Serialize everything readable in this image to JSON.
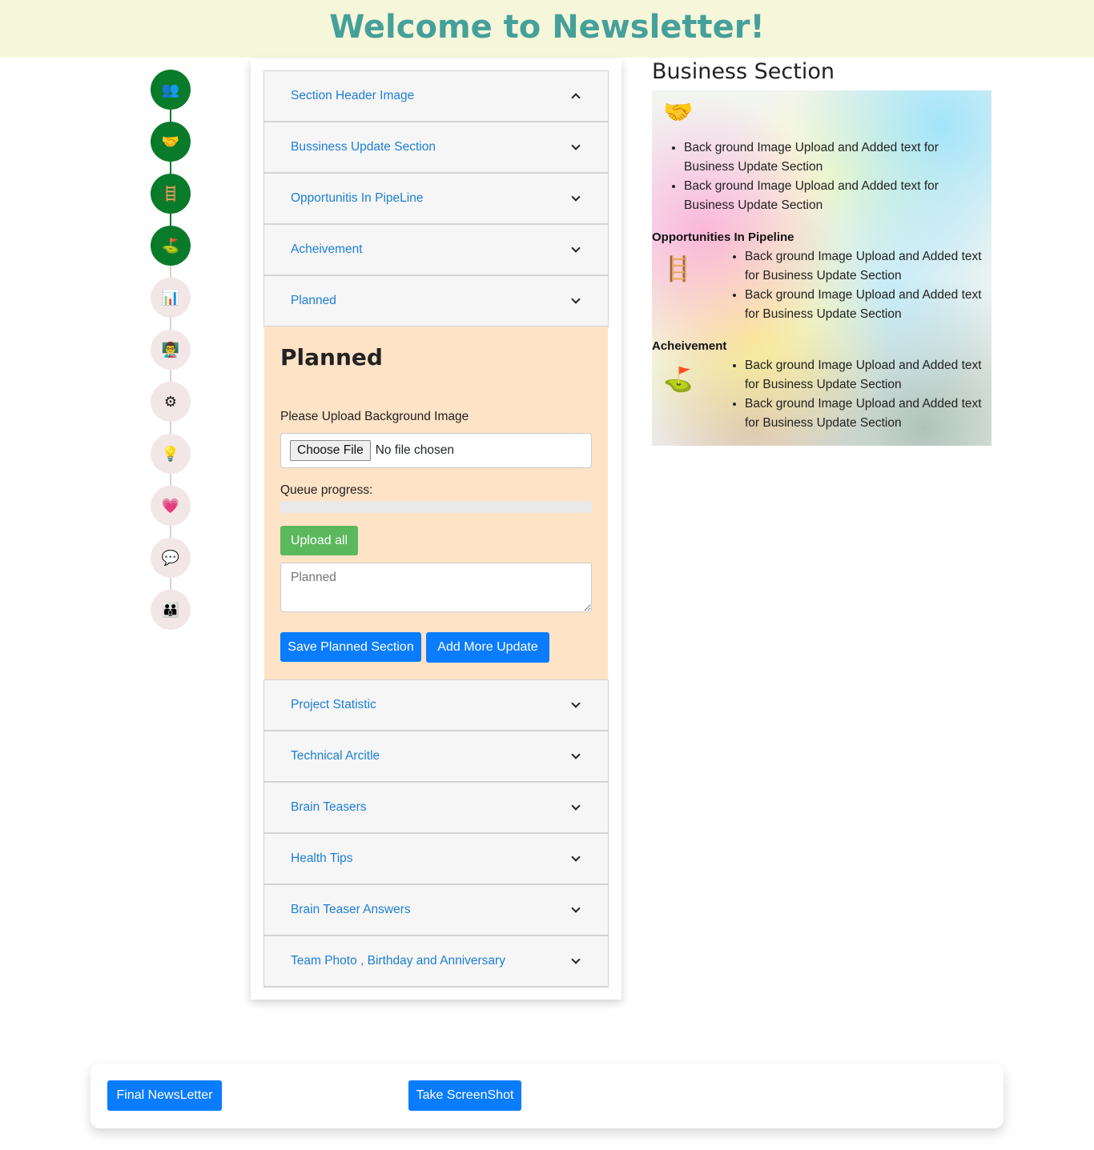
{
  "header": {
    "title": "Welcome to Newsletter!"
  },
  "stepper": {
    "steps": [
      {
        "icon": "team-icon",
        "glyph": "👥",
        "state": "done"
      },
      {
        "icon": "handshake-icon",
        "glyph": "🤝",
        "state": "done"
      },
      {
        "icon": "ladder-climb-icon",
        "glyph": "🪜",
        "state": "done"
      },
      {
        "icon": "flag-summit-icon",
        "glyph": "⛳",
        "state": "done"
      },
      {
        "icon": "chart-board-icon",
        "glyph": "📊",
        "state": "todo"
      },
      {
        "icon": "presenter-icon",
        "glyph": "👨‍🏫",
        "state": "todo"
      },
      {
        "icon": "gears-icon",
        "glyph": "⚙",
        "state": "todo"
      },
      {
        "icon": "lightbulb-icon",
        "glyph": "💡",
        "state": "todo"
      },
      {
        "icon": "heart-pulse-icon",
        "glyph": "💗",
        "state": "todo"
      },
      {
        "icon": "chat-icon",
        "glyph": "💬",
        "state": "todo"
      },
      {
        "icon": "group-icon",
        "glyph": "👪",
        "state": "todo"
      }
    ],
    "done_color": "#0a7b2a",
    "todo_color": "#f3e6e6"
  },
  "editor": {
    "sections_top": [
      {
        "label": "Section Header Image",
        "expanded": true
      },
      {
        "label": "Bussiness Update Section",
        "expanded": false
      },
      {
        "label": "Opportunitis In PipeLine",
        "expanded": false
      },
      {
        "label": "Acheivement",
        "expanded": false
      },
      {
        "label": "Planned",
        "expanded": false
      }
    ],
    "planned": {
      "title": "Planned",
      "upload_label": "Please Upload Background Image",
      "choose_file": "Choose File",
      "no_file": "No file chosen",
      "queue_label": "Queue progress:",
      "queue_progress": 0,
      "upload_all": "Upload all",
      "textarea_placeholder": "Planned",
      "save_button": "Save Planned Section",
      "add_more_button": "Add More Update"
    },
    "sections_bottom": [
      {
        "label": "Project Statistic"
      },
      {
        "label": "Technical Arcitle"
      },
      {
        "label": "Brain Teasers"
      },
      {
        "label": "Health Tips"
      },
      {
        "label": "Brain Teaser Answers"
      },
      {
        "label": "Team Photo , Birthday and Anniversary"
      }
    ]
  },
  "preview": {
    "title": "Business Section",
    "business": {
      "icon": "handshake-icon",
      "items": [
        "Back ground Image Upload and Added text for Business Update Section",
        "Back ground Image Upload and Added text for Business Update Section"
      ]
    },
    "pipeline": {
      "heading": "Opportunities In Pipeline",
      "icon": "ladder-climb-icon",
      "items": [
        "Back ground Image Upload and Added text for Business Update Section",
        "Back ground Image Upload and Added text for Business Update Section"
      ]
    },
    "achievement": {
      "heading": "Acheivement",
      "icon": "flag-summit-icon",
      "items": [
        "Back ground Image Upload and Added text for Business Update Section",
        "Back ground Image Upload and Added text for Business Update Section"
      ]
    }
  },
  "footer": {
    "final_button": "Final NewsLetter",
    "screenshot_button": "Take ScreenShot"
  }
}
